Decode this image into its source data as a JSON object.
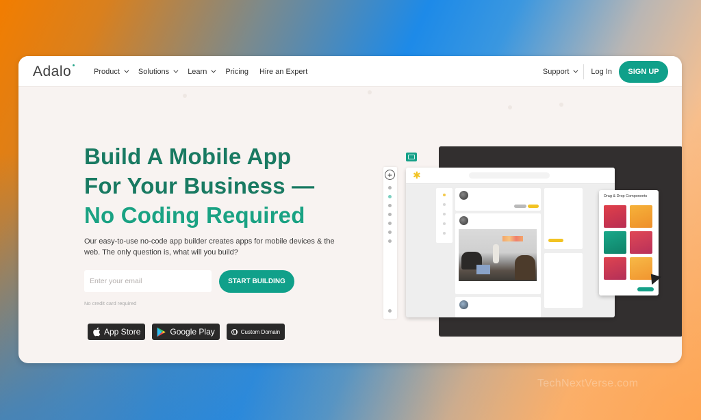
{
  "nav": {
    "logo": "Adalo",
    "links": [
      {
        "label": "Product",
        "has_dropdown": true
      },
      {
        "label": "Solutions",
        "has_dropdown": true
      },
      {
        "label": "Learn",
        "has_dropdown": true
      },
      {
        "label": "Pricing",
        "has_dropdown": false
      },
      {
        "label": "Hire an Expert",
        "has_dropdown": false
      }
    ],
    "support": "Support",
    "login": "Log In",
    "signup": "SIGN UP"
  },
  "hero": {
    "title_line1": "Build A Mobile App",
    "title_line2": "For Your Business —",
    "title_line3": "No Coding Required",
    "description": "Our easy-to-use no-code app builder creates apps for mobile devices & the web. The only question is, what will you build?",
    "email_placeholder": "Enter your email",
    "email_value": "",
    "cta": "START BUILDING",
    "note": "No credit card required"
  },
  "badges": [
    {
      "label": "App Store",
      "icon": "apple-icon"
    },
    {
      "label": "Google Play",
      "icon": "google-play-icon"
    },
    {
      "label": "Custom Domain",
      "icon": "globe-icon"
    }
  ],
  "mockup": {
    "panel_title": "Drag & Drop Components",
    "tile_colors": [
      "#d1384a",
      "#f2a32a",
      "#16a082",
      "#d53e55",
      "#cf3d55",
      "#f3a83a"
    ]
  },
  "colors": {
    "brand_green": "#10a08a",
    "heading_green": "#197a62"
  },
  "watermark": "TechNextVerse.com"
}
